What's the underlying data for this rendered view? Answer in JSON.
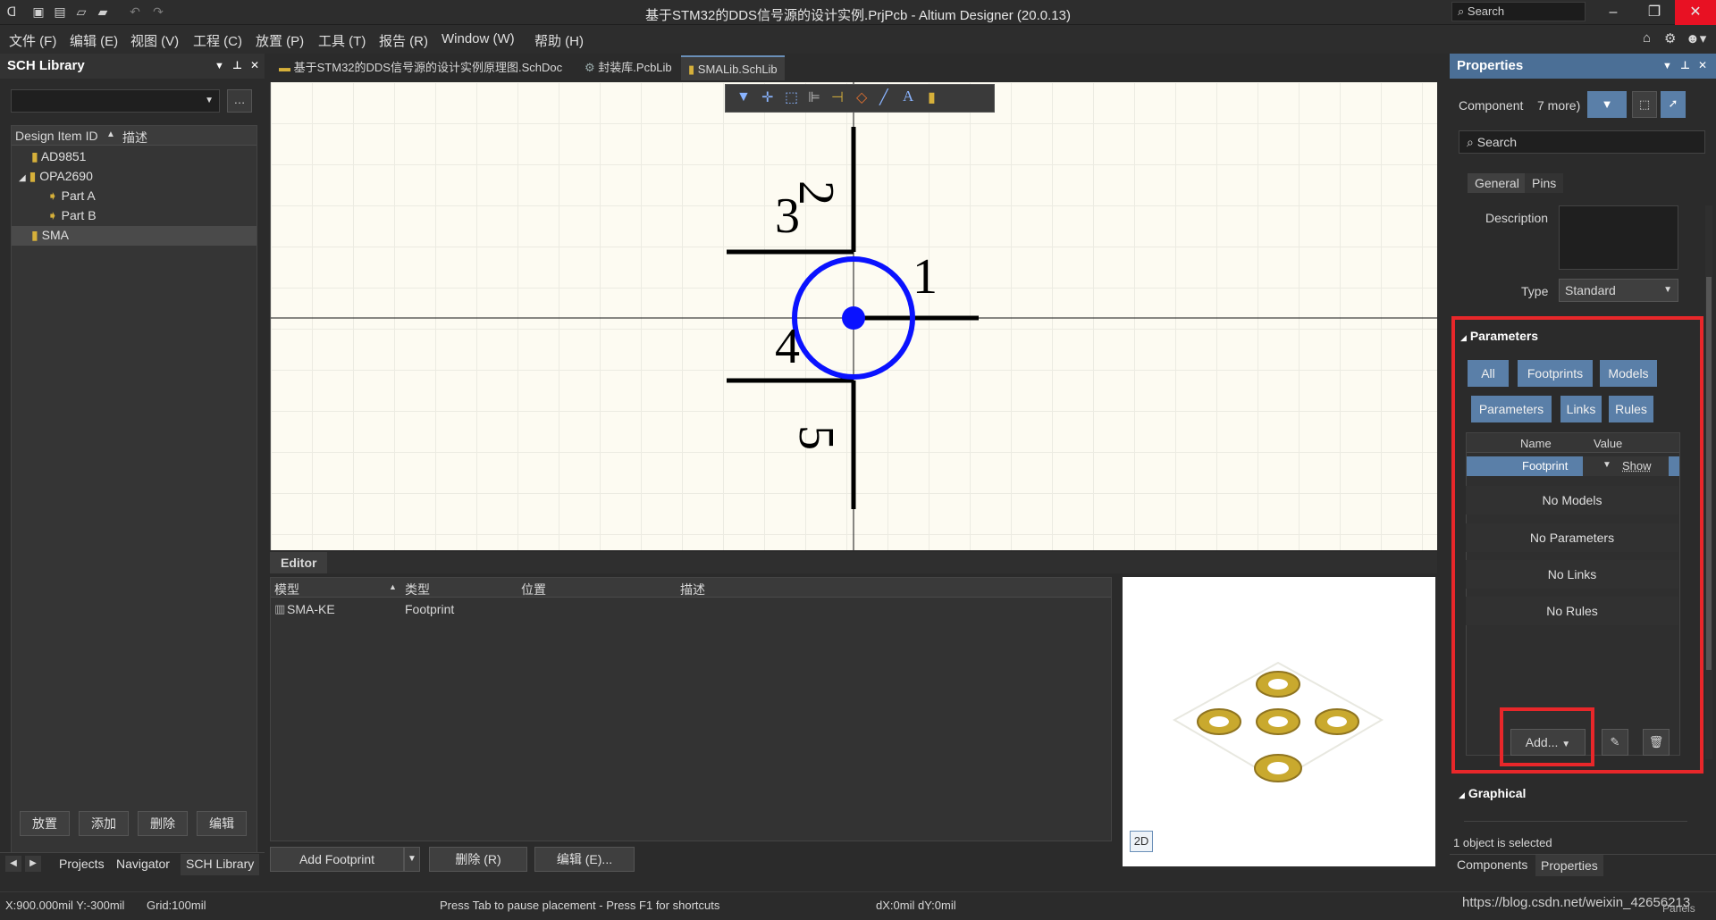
{
  "window": {
    "title": "基于STM32的DDS信号源的设计实例.PrjPcb - Altium Designer (20.0.13)",
    "search_label": "Search"
  },
  "menu": [
    "文件 (F)",
    "编辑 (E)",
    "视图 (V)",
    "工程 (C)",
    "放置 (P)",
    "工具 (T)",
    "报告 (R)",
    "Window (W)",
    "帮助 (H)"
  ],
  "sch_library": {
    "title": "SCH Library",
    "columns": [
      "Design Item ID",
      "描述"
    ],
    "items": [
      "AD9851",
      "OPA2690",
      "Part A",
      "Part B",
      "SMA"
    ],
    "buttons": [
      "放置",
      "添加",
      "删除",
      "编辑"
    ]
  },
  "doc_tabs": [
    "基于STM32的DDS信号源的设计实例原理图.SchDoc",
    "封装库.PcbLib",
    "SMALib.SchLib"
  ],
  "schematic": {
    "pins": [
      "1",
      "2",
      "3",
      "4",
      "5"
    ]
  },
  "editor": {
    "title": "Editor",
    "columns": [
      "模型",
      "类型",
      "位置",
      "描述"
    ],
    "rows": [
      {
        "model": "SMA-KE",
        "type": "Footprint",
        "location": "",
        "desc": ""
      }
    ],
    "buttons": [
      "Add Footprint",
      "删除 (R)",
      "编辑 (E)..."
    ],
    "preview_mode": "2D"
  },
  "left_bottom_tabs": [
    "Projects",
    "Navigator",
    "SCH Library"
  ],
  "properties": {
    "title": "Properties",
    "component_label": "Component",
    "more_label": "7 more)",
    "search_placeholder": "Search",
    "tabs": [
      "General",
      "Pins"
    ],
    "description_label": "Description",
    "type_label": "Type",
    "type_value": "Standard",
    "parameters_title": "Parameters",
    "filter_buttons": [
      "All",
      "Footprints",
      "Models",
      "Parameters",
      "Links",
      "Rules"
    ],
    "table_columns": [
      "Name",
      "Value"
    ],
    "footprint_row": {
      "name": "Footprint",
      "value": "Show"
    },
    "empty_rows": [
      "No Models",
      "No Parameters",
      "No Links",
      "No Rules"
    ],
    "add_button": "Add...",
    "graphical_title": "Graphical",
    "selected_text": "1 object is selected",
    "bottom_tabs": [
      "Components",
      "Properties"
    ]
  },
  "status": {
    "coords": "X:900.000mil Y:-300mil",
    "grid": "Grid:100mil",
    "hint": "Press Tab to pause placement - Press F1 for shortcuts",
    "delta": "dX:0mil dY:0mil",
    "watermark": "https://blog.csdn.net/weixin_42656213",
    "panels": "Panels"
  },
  "colors": {
    "highlight_red": "#e8272a",
    "accent_blue": "#5a7fa8",
    "pin_blue": "#0a12ff"
  }
}
